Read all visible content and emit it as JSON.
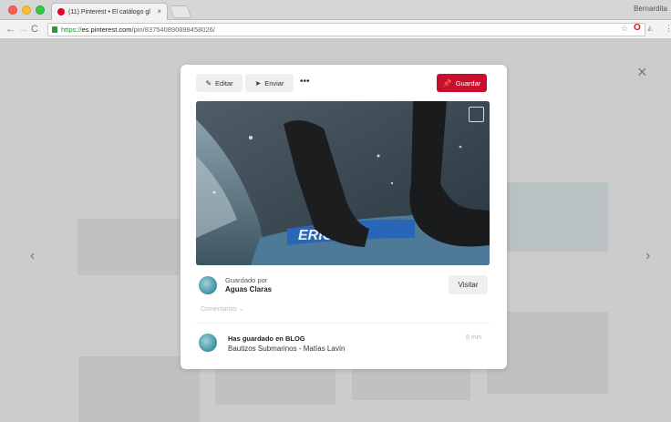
{
  "browser": {
    "tab_title": "(11) Pinterest • El catálogo gl",
    "tab_close": "×",
    "profile": "Bernardita",
    "nav_back": "←",
    "nav_forward": "→",
    "nav_reload": "C",
    "url_scheme": "https://",
    "url_host": "es.pinterest.com",
    "url_path": "/pin/837540890898458026/",
    "icons": [
      "back-icon",
      "forward-icon",
      "reload-icon",
      "lock-icon",
      "star-icon",
      "opera-icon",
      "menu-icon"
    ]
  },
  "page": {
    "close_glyph": "×",
    "arrow_left": "‹",
    "arrow_right": "›"
  },
  "modal": {
    "edit_label": "Editar",
    "send_label": "Enviar",
    "more_label": "•••",
    "save_label": "Guardar",
    "saved_by_label": "Guardado por",
    "saved_by_name": "Aguas Claras",
    "visit_label": "Visitar",
    "comments_label": "Comentarios ⌄",
    "board_prefix": "Has guardado en",
    "board_name": "BLOG",
    "pin_title": "Bautizos Submarinos - Matías Lavín",
    "time_ago": "8 min",
    "photo_text": "ERIC O"
  },
  "colors": {
    "save_red": "#c8102e",
    "pinterest_red": "#e60023"
  }
}
